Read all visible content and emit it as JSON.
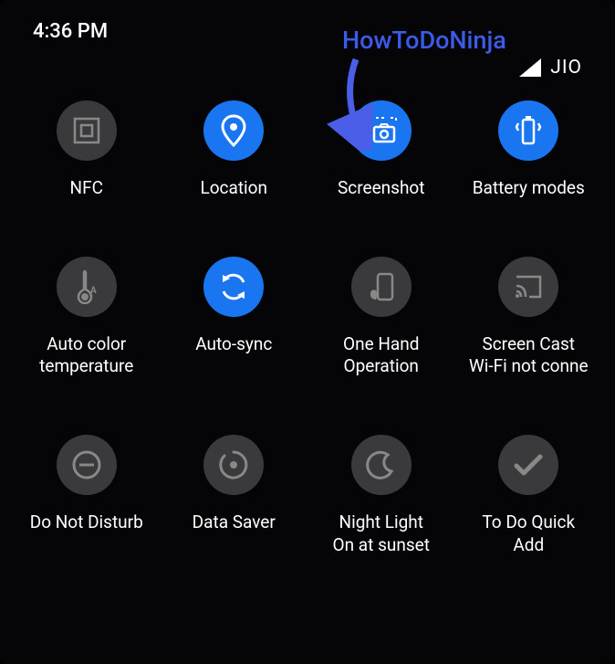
{
  "status": {
    "time": "4:36 PM",
    "carrier": "JIO"
  },
  "overlay": {
    "label": "HowToDoNinja"
  },
  "tiles": [
    {
      "label": "NFC",
      "active": false
    },
    {
      "label": "Location",
      "active": true
    },
    {
      "label": "Screenshot",
      "active": true
    },
    {
      "label": "Battery modes",
      "active": true
    },
    {
      "label": "Auto color\ntemperature",
      "active": false
    },
    {
      "label": "Auto-sync",
      "active": true
    },
    {
      "label": "One Hand\nOperation",
      "active": false
    },
    {
      "label": "Screen Cast\nWi-Fi not conne",
      "active": false
    },
    {
      "label": "Do Not Disturb",
      "active": false
    },
    {
      "label": "Data Saver",
      "active": false
    },
    {
      "label": "Night Light\nOn at sunset",
      "active": false
    },
    {
      "label": "To Do Quick\nAdd",
      "active": false
    }
  ]
}
